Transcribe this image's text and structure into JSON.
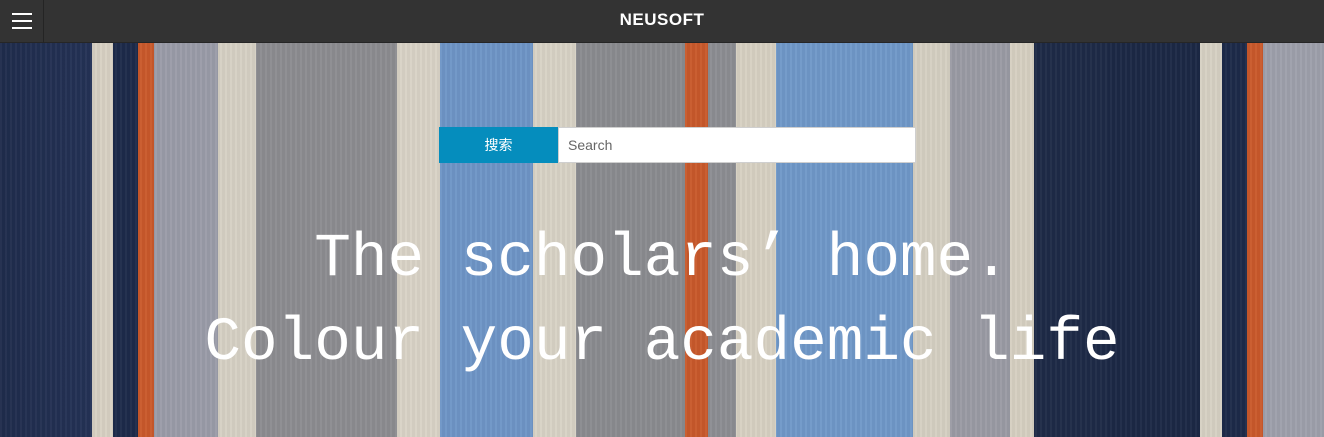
{
  "header": {
    "brand": "NEUSOFT",
    "menu_icon": "hamburger-menu-icon"
  },
  "search": {
    "button_label": "搜索",
    "placeholder": "Search",
    "value": ""
  },
  "hero": {
    "tagline_line1": "The scholars’ home.",
    "tagline_line2": "Colour your academic life"
  },
  "colors": {
    "topbar": "#333333",
    "search_button": "#058dbd",
    "accent_orange": "#c9592b",
    "stripe_blue": "#6e95c6",
    "stripe_navy": "#1f2c4c"
  }
}
